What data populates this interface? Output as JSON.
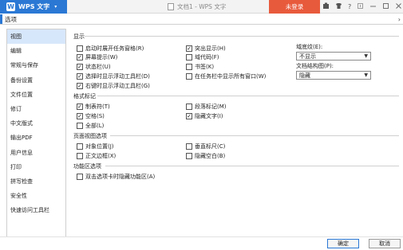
{
  "titlebar": {
    "app_name": "WPS 文字",
    "logo_glyph": "W",
    "dropdown_glyph": "▾",
    "document_title": "文档1 - WPS 文字",
    "login_label": "未登录",
    "icons": [
      "skin-icon",
      "shirt-icon",
      "help-icon",
      "restore-icon",
      "minimize-icon",
      "maximize-icon",
      "close-icon"
    ],
    "help_text": "?",
    "accent_color": "#2a78d4",
    "login_color": "#e85a3c"
  },
  "dialog": {
    "title": "选项",
    "more_glyph": "›"
  },
  "sidebar": {
    "items": [
      {
        "label": "视图",
        "active": true
      },
      {
        "label": "编辑"
      },
      {
        "label": "常规与保存"
      },
      {
        "label": "备份设置"
      },
      {
        "label": "文件位置"
      },
      {
        "label": "修订"
      },
      {
        "label": "中文版式"
      },
      {
        "label": "输出PDF"
      },
      {
        "label": "用户信息"
      },
      {
        "label": "打印"
      },
      {
        "label": "拼写检查"
      },
      {
        "label": "安全性"
      },
      {
        "label": "快速访问工具栏"
      }
    ]
  },
  "display": {
    "section_title": "显示",
    "left": [
      {
        "label": "启动时展开任务窗格(R)",
        "checked": false
      },
      {
        "label": "屏幕提示(W)",
        "checked": true
      },
      {
        "label": "状态栏(U)",
        "checked": true
      },
      {
        "label": "选择时显示浮动工具栏(D)",
        "checked": true
      },
      {
        "label": "右键时显示浮动工具栏(G)",
        "checked": true
      }
    ],
    "middle": [
      {
        "label": "突出显示(H)",
        "checked": true
      },
      {
        "label": "域代码(F)",
        "checked": false
      },
      {
        "label": "书签(K)",
        "checked": false
      },
      {
        "label": "在任务栏中显示所有窗口(W)",
        "checked": false
      }
    ],
    "field_shading_label": "域底纹(E):",
    "field_shading_value": "不显示",
    "doc_structure_label": "文档结构图(P):",
    "doc_structure_value": "隐藏"
  },
  "format_marks": {
    "section_title": "格式标记",
    "items": [
      {
        "label": "制表符(T)",
        "checked": true
      },
      {
        "label": "空格(S)",
        "checked": true
      },
      {
        "label": "全部(L)",
        "checked": false
      },
      {
        "label": "段落标记(M)",
        "checked": false
      },
      {
        "label": "隐藏文字(I)",
        "checked": true
      }
    ]
  },
  "page_view": {
    "section_title": "页面视图选项",
    "items": [
      {
        "label": "对象位置(J)",
        "checked": false
      },
      {
        "label": "正文边框(X)",
        "checked": false
      },
      {
        "label": "垂直标尺(C)",
        "checked": false
      },
      {
        "label": "隐藏空白(B)",
        "checked": false
      }
    ]
  },
  "ribbon": {
    "section_title": "功能区选项",
    "items": [
      {
        "label": "双击选项卡时隐藏功能区(A)",
        "checked": false
      }
    ]
  },
  "footer": {
    "ok_label": "确定",
    "cancel_label": "取消"
  }
}
